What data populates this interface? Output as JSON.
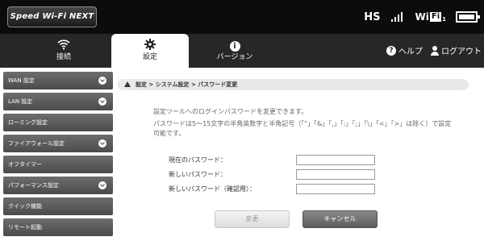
{
  "header": {
    "brand": "Speed Wi-Fi NEXT",
    "mode": "HS",
    "wifi_text": "Wi",
    "wifi_box": "Fi",
    "wifi_sub": "1"
  },
  "nav": {
    "tabs": [
      {
        "label": "接続",
        "icon": "wifi-icon"
      },
      {
        "label": "設定",
        "icon": "gear-icon"
      },
      {
        "label": "バージョン",
        "icon": "info-icon"
      }
    ],
    "help": "ヘルプ",
    "logout": "ログアウト"
  },
  "sidebar": {
    "items": [
      {
        "label": "WAN 設定",
        "expandable": true
      },
      {
        "label": "LAN 設定",
        "expandable": true
      },
      {
        "label": "ローミング設定",
        "expandable": false
      },
      {
        "label": "ファイアウォール設定",
        "expandable": true
      },
      {
        "label": "オフタイマー",
        "expandable": false
      },
      {
        "label": "パフォーマンス設定",
        "expandable": true
      },
      {
        "label": "クイック機能",
        "expandable": false
      },
      {
        "label": "リモート起動",
        "expandable": false
      }
    ]
  },
  "breadcrumb": "設定 > システム設定 > パスワード変更",
  "main": {
    "desc1": "設定ツールへのログインパスワードを変更できます。",
    "desc2": "パスワードは5～15文字の半角英数字と半角記号（「\"」「&」「,」「:」「;」「\\」「<」「>」は除く）で設定可能です。",
    "fields": [
      {
        "label": "現在のパスワード：",
        "value": ""
      },
      {
        "label": "新しいパスワード：",
        "value": ""
      },
      {
        "label": "新しいパスワード（確認用）：",
        "value": ""
      }
    ],
    "change_button": "変更",
    "cancel_button": "キャンセル"
  },
  "colors": {
    "topbar": "#0c0c0c",
    "navbar": "#272727",
    "sidebar_item": "#5a5a5a",
    "breadcrumb_bg": "#e9e9e9"
  }
}
